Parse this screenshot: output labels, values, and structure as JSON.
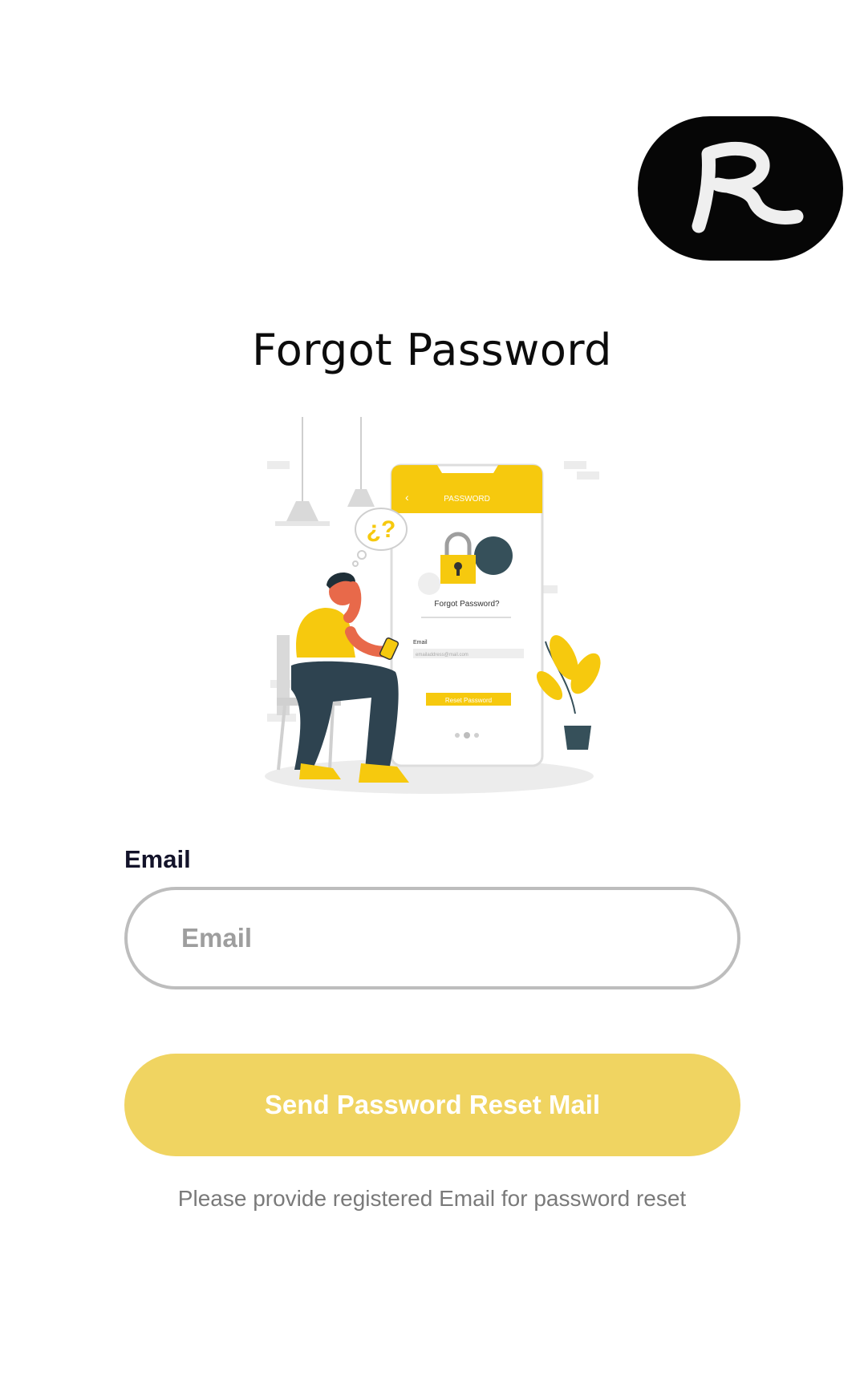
{
  "logo": {
    "icon": "rc-logo-icon",
    "letters": "RC"
  },
  "page": {
    "title": "Forgot Password"
  },
  "illustration": {
    "icon": "forgot-password-illustration",
    "phone_header": "PASSWORD",
    "phone_heading": "Forgot Password?",
    "phone_email_label": "Email",
    "phone_email_value": "emailaddress@mail.com",
    "phone_button": "Reset Password"
  },
  "form": {
    "email_label": "Email",
    "email_placeholder": "Email",
    "email_value": "",
    "submit_label": "Send Password Reset Mail",
    "hint": "Please provide registered Email for password reset"
  },
  "colors": {
    "accent": "#f0d461",
    "illustration_yellow": "#f6c90e",
    "text_dark": "#13132a",
    "input_border": "#bdbdbd"
  }
}
